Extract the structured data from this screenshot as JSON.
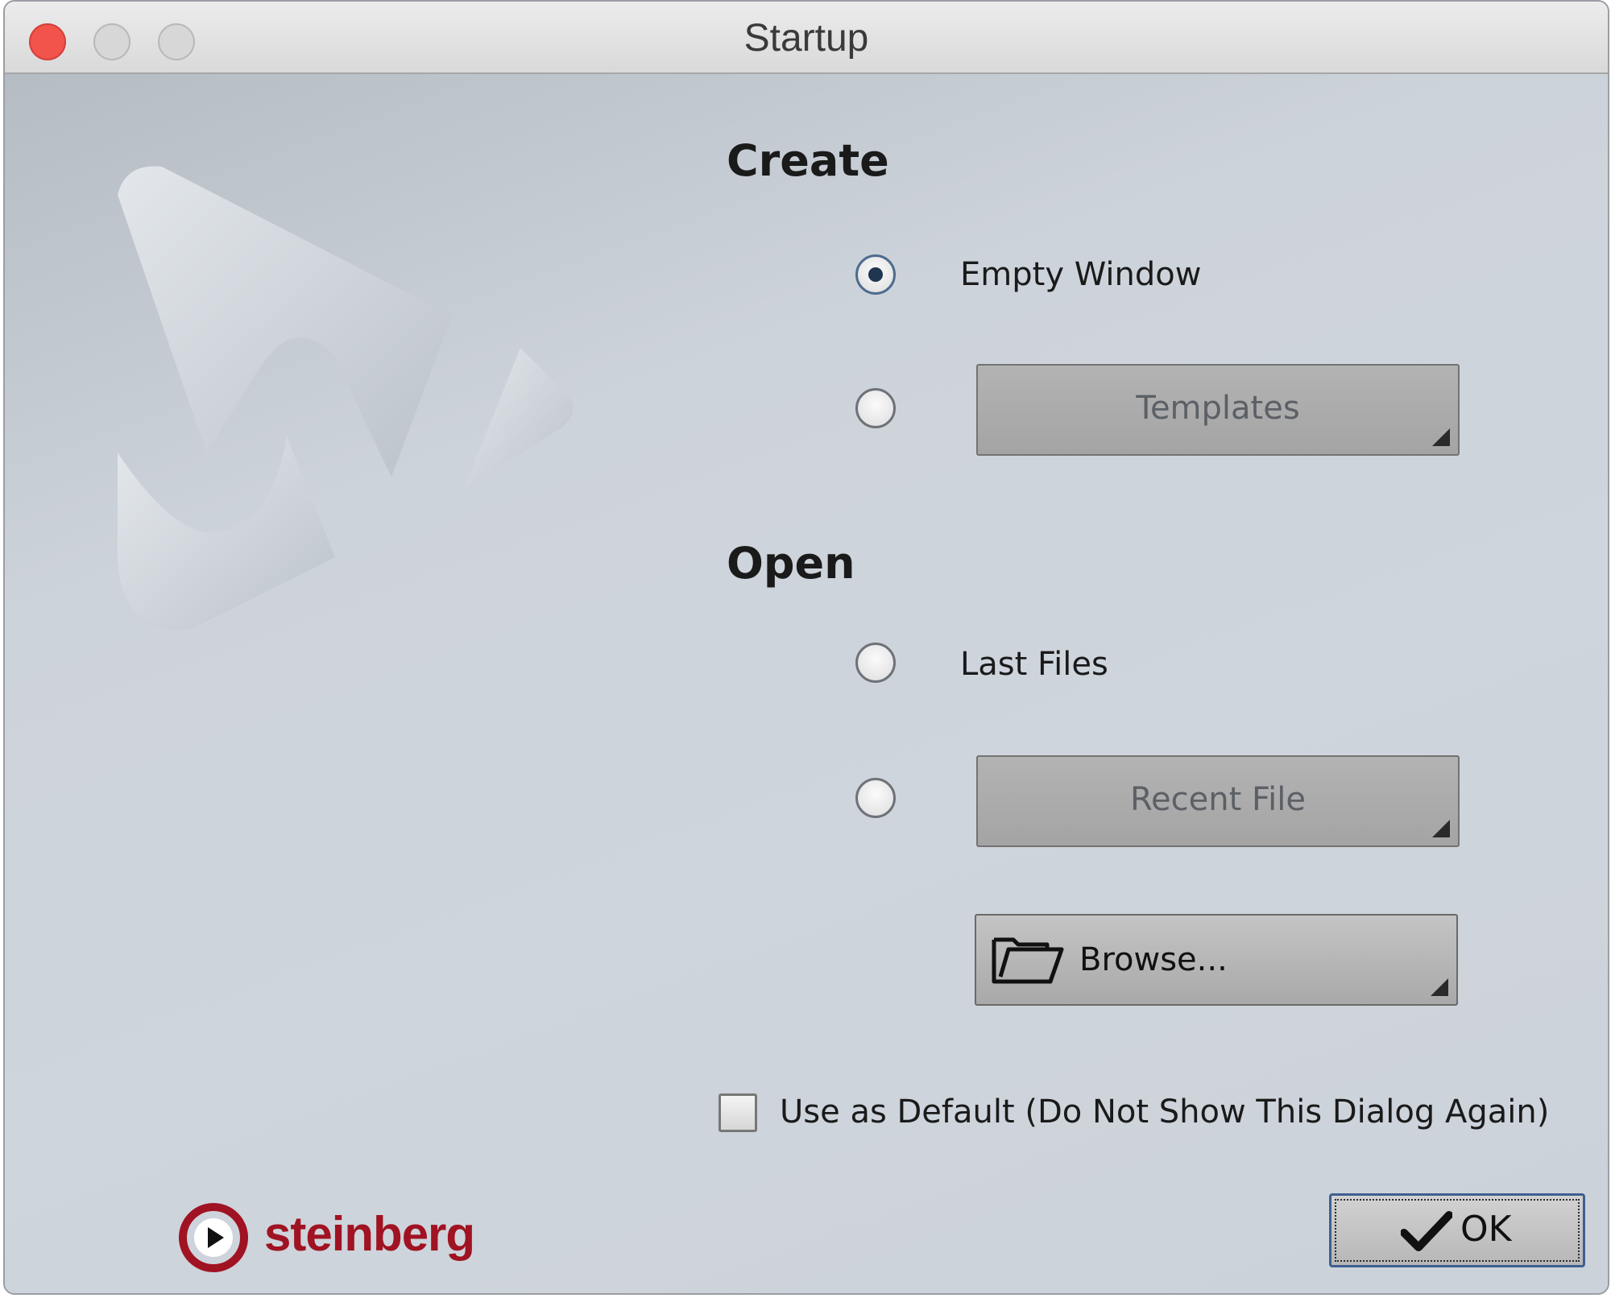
{
  "window": {
    "title": "Startup"
  },
  "create": {
    "heading": "Create",
    "options": [
      {
        "label": "Empty Window",
        "selected": true
      },
      {
        "label": "Templates",
        "selected": false
      }
    ]
  },
  "open": {
    "heading": "Open",
    "options": [
      {
        "label": "Last Files",
        "selected": false
      },
      {
        "label": "Recent File",
        "selected": false
      }
    ],
    "browse_label": "Browse..."
  },
  "default_checkbox": {
    "label": "Use as Default (Do Not Show This Dialog Again)",
    "checked": false
  },
  "brand": {
    "name": "steinberg",
    "color": "#a01322"
  },
  "ok_label": "OK",
  "icons": {
    "browse": "folder-icon",
    "ok": "checkmark-icon"
  }
}
